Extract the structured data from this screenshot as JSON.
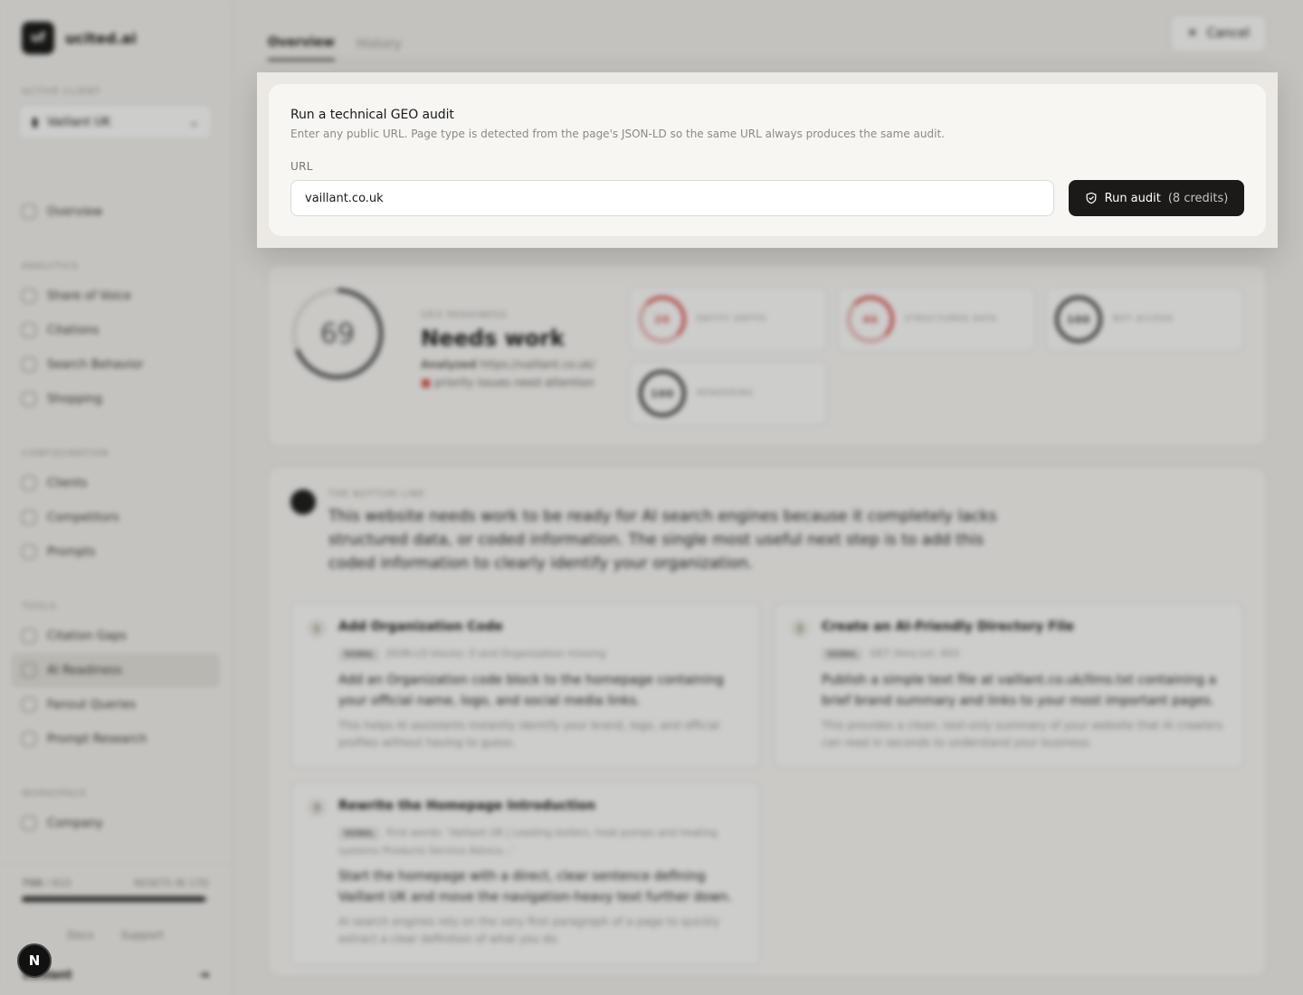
{
  "app": {
    "brand": {
      "logo_text": "uf",
      "name": "ucited.ai"
    },
    "sidebar": {
      "active_client_label": "Active client",
      "client_name": "Vaillant UK",
      "top_items": [
        {
          "label": "Overview",
          "icon": "grid-icon"
        }
      ],
      "analytics_label": "Analytics",
      "analytics_items": [
        {
          "label": "Share of Voice",
          "icon": "chart-icon"
        },
        {
          "label": "Citations",
          "icon": "globe-icon"
        },
        {
          "label": "Search Behavior",
          "icon": "trend-icon"
        },
        {
          "label": "Shopping",
          "icon": "cart-icon"
        }
      ],
      "configuration_label": "Configuration",
      "configuration_items": [
        {
          "label": "Clients",
          "icon": "globe-icon"
        },
        {
          "label": "Competitors",
          "icon": "users-icon"
        },
        {
          "label": "Prompts",
          "icon": "message-icon"
        }
      ],
      "tools_label": "Tools",
      "tools_items": [
        {
          "label": "Citation Gaps",
          "icon": "gap-icon"
        },
        {
          "label": "AI Readiness",
          "icon": "shield-icon",
          "active": true
        },
        {
          "label": "Fanout Queries",
          "icon": "search-icon"
        },
        {
          "label": "Prompt Research",
          "icon": "flask-icon"
        }
      ],
      "workspace_label": "Workspace",
      "workspace_items": [
        {
          "label": "Company",
          "icon": "building-icon"
        }
      ],
      "footer": {
        "credits_used": "798",
        "credits_total": "/ 810",
        "reset_text": "RESETS IN 17D",
        "credits_fraction": 0.98,
        "docs_label": "Docs",
        "support_label": "Support",
        "user_name": "Vaillant"
      }
    },
    "main": {
      "tabs": [
        {
          "label": "Overview",
          "active": true
        },
        {
          "label": "History",
          "active": false
        }
      ],
      "cancel_label": "Cancel",
      "score": {
        "value": "69",
        "fraction": 0.69,
        "kicker": "GEO readiness",
        "headline": "Needs work",
        "analyzed_label": "Analyzed",
        "analyzed_url": "https://vaillant.co.uk/",
        "issues_text": "priority issues need attention"
      },
      "sub_scores": [
        {
          "value": "20",
          "label": "Entity depth",
          "status": "bad"
        },
        {
          "value": "46",
          "label": "Structured data",
          "status": "bad"
        },
        {
          "value": "100",
          "label": "Bot access",
          "status": "ok"
        },
        {
          "value": "100",
          "label": "Rendering",
          "status": "ok"
        }
      ],
      "bottom_line": {
        "kicker": "The bottom line",
        "text": "This website needs work to be ready for AI search engines because it completely lacks structured data, or coded information. The single most useful next step is to add this coded information to clearly identify your organization."
      },
      "steps": [
        {
          "num": "1",
          "title": "Add Organization Code",
          "tag": "SIGNAL",
          "sub": "JSON-LD blocks: 0 and Organization missing",
          "body": "Add an Organization code block to the homepage containing your official name, logo, and social media links.",
          "why": "This helps AI assistants instantly identify your brand, logo, and official profiles without having to guess."
        },
        {
          "num": "2",
          "title": "Create an AI-Friendly Directory File",
          "tag": "SIGNAL",
          "sub": "GET /llms.txt: 403",
          "body": "Publish a simple text file at vaillant.co.uk/llms.txt containing a brief brand summary and links to your most important pages.",
          "why": "This provides a clean, text-only summary of your website that AI crawlers can read in seconds to understand your business."
        },
        {
          "num": "3",
          "title": "Rewrite the Homepage Introduction",
          "tag": "SIGNAL",
          "sub": "First words: 'Vaillant UK | Leading boilers, heat pumps and heating systems Products Service Advice...'",
          "body": "Start the homepage with a direct, clear sentence defining Vaillant UK and move the navigation-heavy text further down.",
          "why": "AI search engines rely on the very first paragraph of a page to quickly extract a clear definition of what you do."
        }
      ]
    }
  },
  "dialog": {
    "title": "Run a technical GEO audit",
    "description": "Enter any public URL. Page type is detected from the page's JSON-LD so the same URL always produces the same audit.",
    "url_label": "URL",
    "url_value": "vaillant.co.uk",
    "run_label": "Run audit",
    "credits_label": "(8 credits)",
    "run_icon": "shield-check-icon"
  },
  "dev_badge": {
    "label": "N"
  },
  "colors": {
    "primary": "#1c1a18",
    "danger": "#d9534f",
    "surface": "#f7f6f3"
  }
}
